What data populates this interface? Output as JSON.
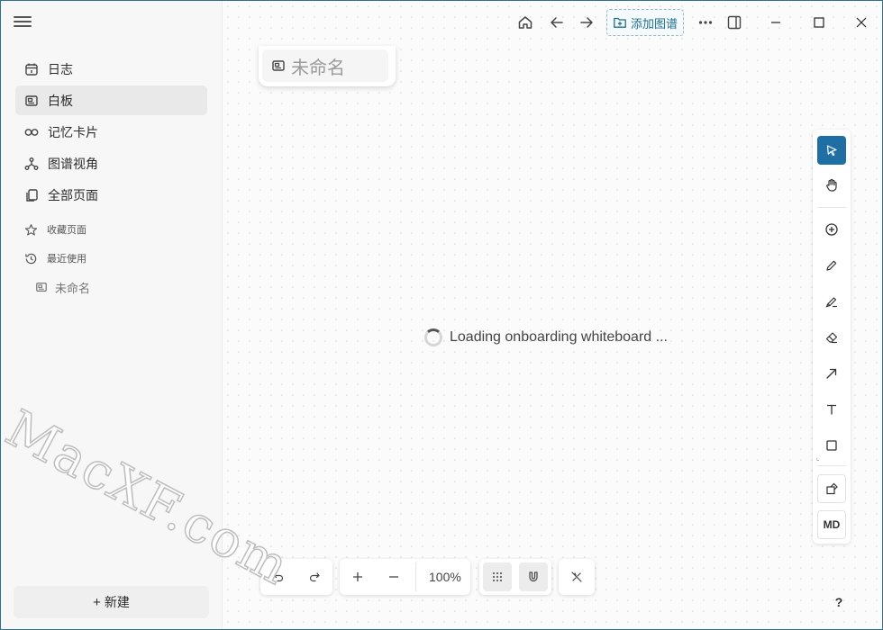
{
  "sidebar": {
    "nav": [
      {
        "label": "日志",
        "icon": "calendar-icon"
      },
      {
        "label": "白板",
        "icon": "whiteboard-icon"
      },
      {
        "label": "记忆卡片",
        "icon": "infinity-icon"
      },
      {
        "label": "图谱视角",
        "icon": "graph-icon"
      },
      {
        "label": "全部页面",
        "icon": "pages-icon"
      }
    ],
    "favorites_label": "收藏页面",
    "recent_label": "最近使用",
    "recent_items": [
      {
        "label": "未命名"
      }
    ],
    "new_button": "新建"
  },
  "topbar": {
    "add_graph": "添加图谱"
  },
  "whiteboard": {
    "title": "未命名",
    "loading_text": "Loading onboarding whiteboard ...",
    "zoom": "100%"
  },
  "right_toolbar": {
    "md_label": "MD"
  },
  "help_label": "?",
  "watermark": "MacXF.com",
  "colors": {
    "accent": "#1f6fa5",
    "sidebar_bg": "#f7f7f7"
  }
}
